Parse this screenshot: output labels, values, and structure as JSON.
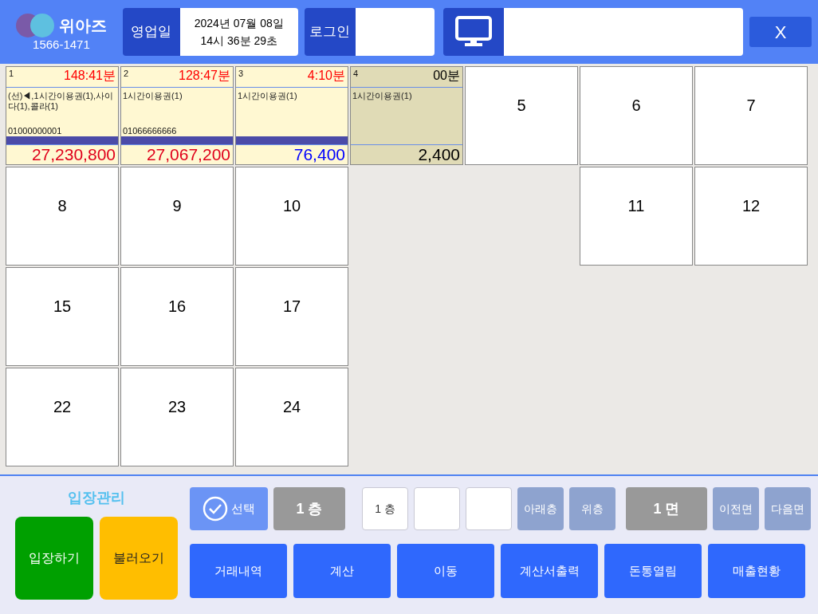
{
  "header": {
    "logo": {
      "name": "위아즈",
      "phone": "1566-1471"
    },
    "business_day": {
      "label": "영업일",
      "date": "2024년 07월 08일",
      "time": "14시 36분 29초"
    },
    "login": {
      "label": "로그인"
    },
    "close": "X"
  },
  "tiles": [
    {
      "kind": "occupied",
      "number": "1",
      "time": {
        "text": "148:41분",
        "color": "#ff0000"
      },
      "items": "(선)◀,1시간이용권(1),사이다(1),콜라(1)",
      "phone": "01000000001",
      "ended": false,
      "amount": {
        "text": "27,230,800",
        "color": "#e0001b"
      }
    },
    {
      "kind": "occupied",
      "number": "2",
      "time": {
        "text": "128:47분",
        "color": "#ff0000"
      },
      "items": "1시간이용권(1)",
      "phone": "01066666666",
      "ended": false,
      "amount": {
        "text": "27,067,200",
        "color": "#e0001b"
      }
    },
    {
      "kind": "occupied",
      "number": "3",
      "time": {
        "text": "4:10분",
        "color": "#ff0000"
      },
      "items": "1시간이용권(1)",
      "ended": false,
      "amount": {
        "text": "76,400",
        "color": "#0000ff"
      }
    },
    {
      "kind": "occupied",
      "number": "4",
      "time": {
        "text": "00분",
        "color": "#000000"
      },
      "items": "1시간이용권(1)",
      "ended": true,
      "amount": {
        "text": "2,400",
        "color": "#000000"
      }
    },
    {
      "kind": "empty",
      "number": "5"
    },
    {
      "kind": "empty",
      "number": "6"
    },
    {
      "kind": "empty",
      "number": "7"
    },
    {
      "kind": "empty",
      "number": "8"
    },
    {
      "kind": "empty",
      "number": "9"
    },
    {
      "kind": "empty",
      "number": "10"
    },
    {
      "kind": "blank"
    },
    {
      "kind": "blank"
    },
    {
      "kind": "empty",
      "number": "11"
    },
    {
      "kind": "empty",
      "number": "12"
    },
    {
      "kind": "empty",
      "number": "15"
    },
    {
      "kind": "empty",
      "number": "16"
    },
    {
      "kind": "empty",
      "number": "17"
    },
    {
      "kind": "blank"
    },
    {
      "kind": "blank"
    },
    {
      "kind": "blank"
    },
    {
      "kind": "blank"
    },
    {
      "kind": "empty",
      "number": "22"
    },
    {
      "kind": "empty",
      "number": "23"
    },
    {
      "kind": "empty",
      "number": "24"
    }
  ],
  "entry": {
    "title": "입장관리",
    "buttons": [
      {
        "label": "입장하기",
        "kind": "enter"
      },
      {
        "label": "불러오기",
        "kind": "load"
      }
    ]
  },
  "toolbar": [
    {
      "kind": "select",
      "label": "선택"
    },
    {
      "kind": "display",
      "label": "1 층"
    },
    {
      "kind": "box",
      "label": "1 층"
    },
    {
      "kind": "box"
    },
    {
      "kind": "box"
    },
    {
      "kind": "nav",
      "label": "아래층"
    },
    {
      "kind": "nav",
      "label": "위층"
    },
    {
      "kind": "display",
      "label": "1 면"
    },
    {
      "kind": "nav",
      "label": "이전면"
    },
    {
      "kind": "nav",
      "label": "다음면"
    }
  ],
  "actions": [
    "거래내역",
    "계산",
    "이동",
    "계산서출력",
    "돈통열림",
    "매출현황"
  ]
}
